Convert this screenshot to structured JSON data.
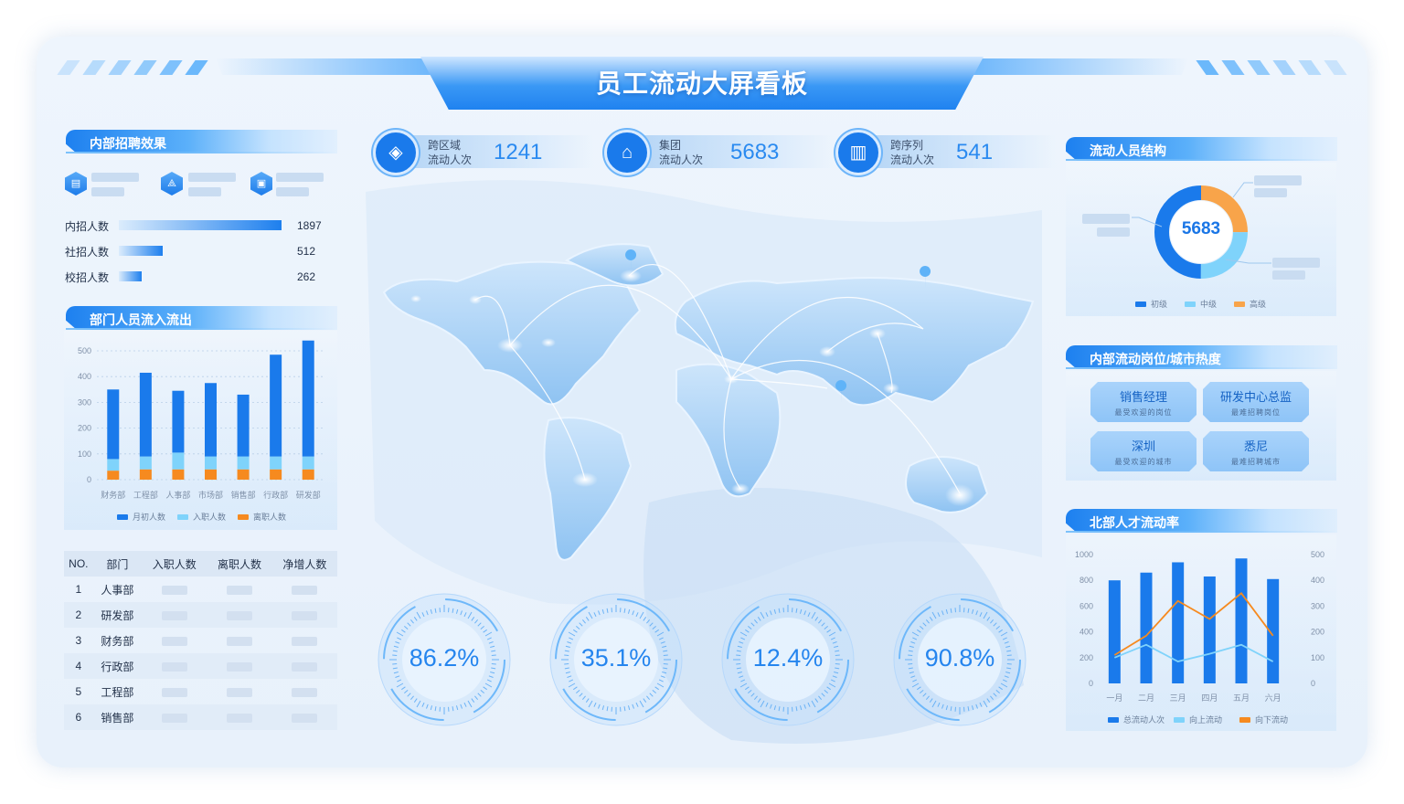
{
  "header": {
    "title": "员工流动大屏看板"
  },
  "recruit": {
    "title": "内部招聘效果",
    "bars": [
      {
        "label": "内招人数",
        "value": 1897
      },
      {
        "label": "社招人数",
        "value": 512
      },
      {
        "label": "校招人数",
        "value": 262
      }
    ]
  },
  "dept_flow": {
    "title": "部门人员流入流出",
    "chart_data": {
      "type": "bar",
      "categories": [
        "财务部",
        "工程部",
        "人事部",
        "市场部",
        "销售部",
        "行政部",
        "研发部"
      ],
      "series": [
        {
          "name": "月初人数",
          "values": [
            270,
            325,
            240,
            285,
            240,
            395,
            450
          ]
        },
        {
          "name": "入职人数",
          "values": [
            45,
            50,
            65,
            50,
            50,
            50,
            50
          ]
        },
        {
          "name": "离职人数",
          "values": [
            35,
            40,
            40,
            40,
            40,
            40,
            40
          ]
        }
      ],
      "yticks": [
        "500",
        "400",
        "300",
        "200",
        "100",
        "0"
      ],
      "ylim": [
        0,
        500
      ],
      "colors": [
        "#1a7aeb",
        "#7fd3fb",
        "#f68a1f"
      ],
      "legend": "bottom"
    }
  },
  "dept_table": {
    "headers": [
      "NO.",
      "部门",
      "入职人数",
      "离职人数",
      "净增人数"
    ],
    "rows": [
      {
        "no": "1",
        "dept": "人事部"
      },
      {
        "no": "2",
        "dept": "研发部"
      },
      {
        "no": "3",
        "dept": "财务部"
      },
      {
        "no": "4",
        "dept": "行政部"
      },
      {
        "no": "5",
        "dept": "工程部"
      },
      {
        "no": "6",
        "dept": "销售部"
      }
    ]
  },
  "kpis": [
    {
      "icon": "layers-icon",
      "name1": "跨区域",
      "name2": "流动人次",
      "value": "1241"
    },
    {
      "icon": "bank-icon",
      "name1": "集团",
      "name2": "流动人次",
      "value": "5683"
    },
    {
      "icon": "building-icon",
      "name1": "跨序列",
      "name2": "流动人次",
      "value": "541"
    }
  ],
  "gauges": [
    {
      "value": "86.2%",
      "fraction": 0.862
    },
    {
      "value": "35.1%",
      "fraction": 0.351
    },
    {
      "value": "12.4%",
      "fraction": 0.124
    },
    {
      "value": "90.8%",
      "fraction": 0.908
    }
  ],
  "structure": {
    "title": "流动人员结构",
    "center_value": "5683",
    "chart_data": {
      "type": "pie",
      "series": [
        {
          "name": "初级",
          "value": 50
        },
        {
          "name": "中级",
          "value": 25
        },
        {
          "name": "高级",
          "value": 25
        }
      ],
      "colors": [
        "#1a7aeb",
        "#7fd3fb",
        "#f8a44a"
      ],
      "legend": "bottom"
    }
  },
  "heat": {
    "title": "内部流动岗位/城市热度",
    "items": [
      {
        "title": "销售经理",
        "sub": "最受欢迎的岗位"
      },
      {
        "title": "研发中心总监",
        "sub": "最难招聘岗位"
      },
      {
        "title": "深圳",
        "sub": "最受欢迎的城市"
      },
      {
        "title": "悉尼",
        "sub": "最难招聘城市"
      }
    ]
  },
  "north": {
    "title": "北部人才流动率",
    "chart_data": {
      "type": "bar",
      "categories": [
        "一月",
        "二月",
        "三月",
        "四月",
        "五月",
        "六月"
      ],
      "series": [
        {
          "name": "总流动人次",
          "type": "bar",
          "axis": "left",
          "values": [
            800,
            860,
            940,
            830,
            970,
            810
          ]
        },
        {
          "name": "向上流动",
          "type": "line",
          "axis": "right",
          "values": [
            100,
            150,
            85,
            115,
            150,
            85
          ]
        },
        {
          "name": "向下流动",
          "type": "line",
          "axis": "right",
          "values": [
            110,
            185,
            320,
            250,
            350,
            185
          ]
        }
      ],
      "yticks_left": [
        "1000",
        "800",
        "600",
        "400",
        "200",
        "0"
      ],
      "yticks_right": [
        "500",
        "400",
        "300",
        "200",
        "100",
        "0"
      ],
      "ylim_left": [
        0,
        1000
      ],
      "ylim_right": [
        0,
        500
      ],
      "colors": [
        "#1a7aeb",
        "#7fd3fb",
        "#f68a1f"
      ],
      "legend": "bottom"
    }
  }
}
